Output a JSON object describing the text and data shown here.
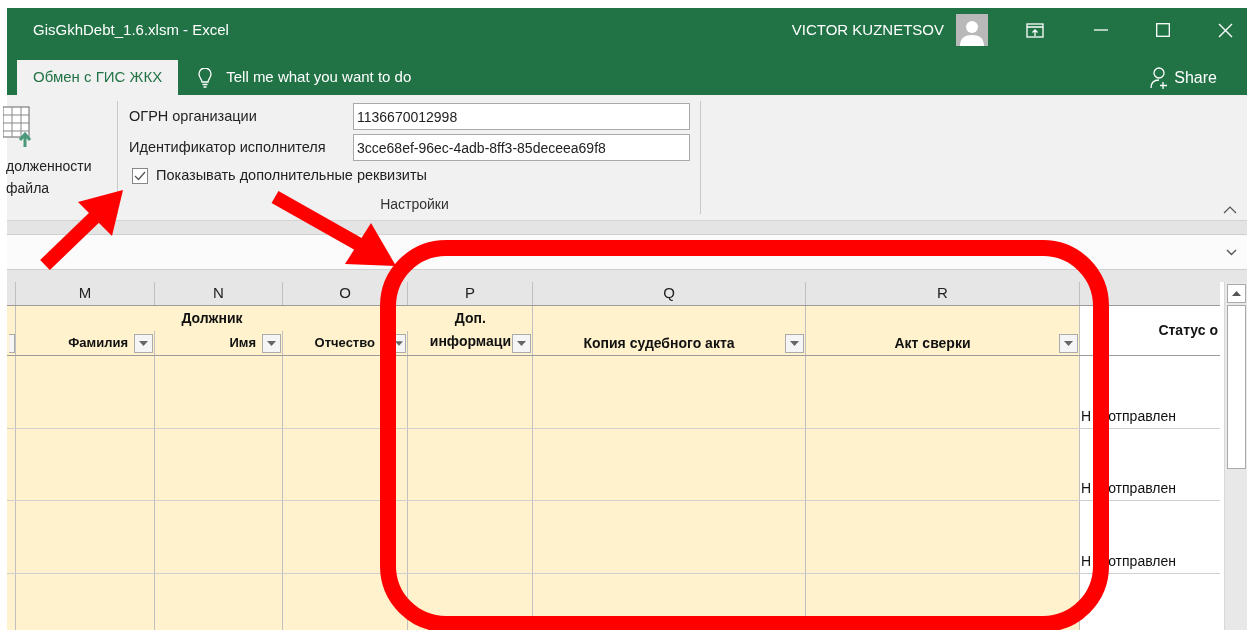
{
  "window": {
    "title": "GisGkhDebt_1.6.xlsm  -  Excel",
    "user": "VICTOR KUZNETSOV"
  },
  "tabs": [
    {
      "label": "Обмен с ГИС ЖКХ",
      "selected": true
    }
  ],
  "tell_me": "Tell me what you want to do",
  "share": "Share",
  "ribbon": {
    "left_button_lines": [
      "долженности",
      "файла"
    ],
    "fields": [
      {
        "label": "ОГРН организации",
        "value": "1136670012998"
      },
      {
        "label": "Идентификатор исполнителя",
        "value": "3cce68ef-96ec-4adb-8ff3-85deceea69f8"
      }
    ],
    "checkbox": {
      "label": "Показывать дополнительные реквизиты",
      "checked": true
    },
    "group_label": "Настройки"
  },
  "sheet": {
    "column_letters": [
      "M",
      "N",
      "O",
      "P",
      "Q",
      "R"
    ],
    "group": {
      "label": "Должник",
      "columns": [
        "Фамилия",
        "Имя",
        "Отчество"
      ]
    },
    "wrapped_header": [
      "Доп.",
      "информаци"
    ],
    "headers": [
      "Копия судебного акта",
      "Акт сверки"
    ],
    "status_header": "Статус о",
    "rows": [
      {
        "status": [
          "Н",
          "отправлен"
        ]
      },
      {
        "status": [
          "Н",
          "отправлен"
        ]
      },
      {
        "status": [
          "Н",
          "отправлен"
        ]
      },
      {}
    ]
  }
}
